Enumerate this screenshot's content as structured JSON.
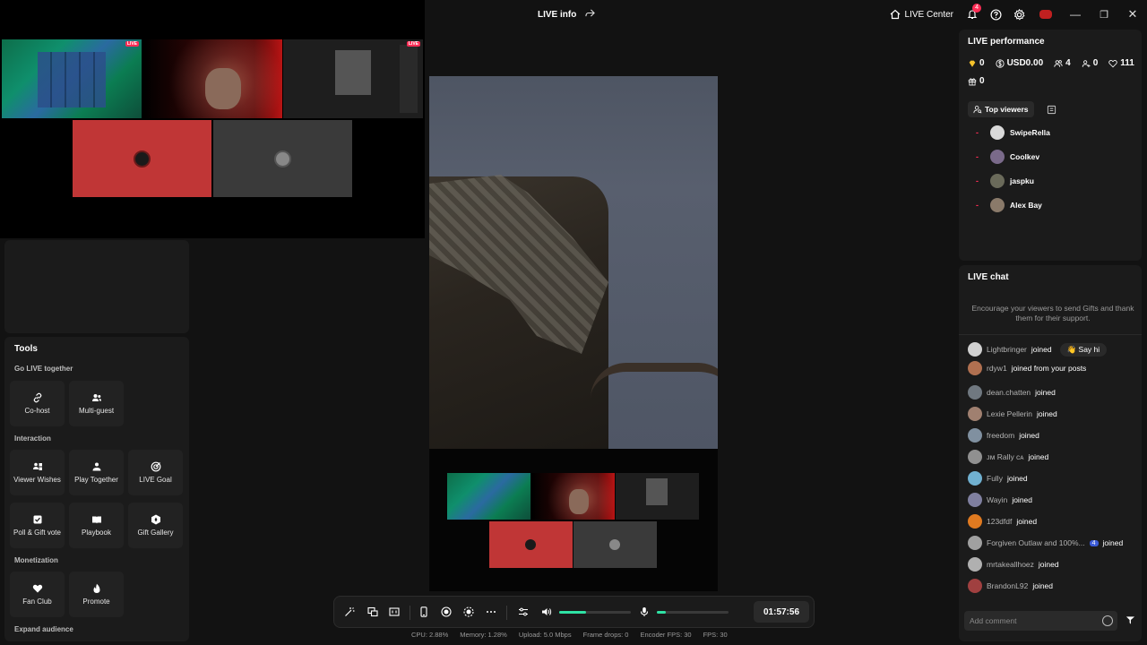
{
  "topbar": {
    "title": "LIVE info",
    "live_center": "LIVE Center",
    "notification_count": "4"
  },
  "tools": {
    "title": "Tools",
    "sections": {
      "go_live_together": "Go LIVE together",
      "interaction": "Interaction",
      "monetization": "Monetization",
      "expand_audience": "Expand audience"
    },
    "cohost": "Co-host",
    "multiguest": "Multi-guest",
    "viewer_wishes": "Viewer Wishes",
    "play_together": "Play Together",
    "live_goal": "LIVE Goal",
    "poll_gift_vote": "Poll & Gift vote",
    "playbook": "Playbook",
    "gift_gallery": "Gift Gallery",
    "fan_club": "Fan Club",
    "promote": "Promote"
  },
  "controls": {
    "timer": "01:57:56",
    "volume_level": 0.38,
    "mic_level": 0.12
  },
  "stats": {
    "cpu": "CPU:  2.88%",
    "memory": "Memory:  1.28%",
    "upload": "Upload:  5.0 Mbps",
    "frame_drops": "Frame drops:  0",
    "encoder_fps": "Encoder FPS:  30",
    "fps": "FPS:  30"
  },
  "performance": {
    "title": "LIVE performance",
    "diamonds": "0",
    "usd": "USD0.00",
    "viewers": "4",
    "new_followers": "0",
    "likes": "111",
    "gifts": "0",
    "top_viewers_tab": "Top viewers",
    "top_viewers": [
      {
        "name": "SwipeRella",
        "color": "#d9d9d9"
      },
      {
        "name": "Coolkev",
        "color": "#7a6a8a"
      },
      {
        "name": "jaspku",
        "color": "#6a6a5a"
      },
      {
        "name": "Alex Bay",
        "color": "#8a7a6a"
      }
    ]
  },
  "chat": {
    "title": "LIVE chat",
    "hint": "Encourage your viewers to send Gifts and thank them for their support.",
    "say_hi": "Say hi",
    "comment_placeholder": "Add comment",
    "messages": [
      {
        "user": "Lightbringer",
        "text": "joined",
        "color": "#d0d0d0"
      },
      {
        "user": "rdyw1",
        "text": "joined from your posts",
        "color": "#b07050"
      },
      {
        "user": "dean.chatten",
        "text": "joined",
        "color": "#707880"
      },
      {
        "user": "Lexie Pellerin",
        "text": "joined",
        "color": "#a08070"
      },
      {
        "user": "freedom",
        "text": "joined",
        "color": "#8090a0"
      },
      {
        "user": "ᴊᴍ Rally ᴄᴀ",
        "text": "joined",
        "color": "#909090"
      },
      {
        "user": "Fully",
        "text": "joined",
        "color": "#70b0d0"
      },
      {
        "user": "Wayin",
        "text": "joined",
        "color": "#8080a0"
      },
      {
        "user": "123dfdf",
        "text": "joined",
        "color": "#e07a20"
      },
      {
        "user": "Forgiven Outlaw and 100%...",
        "text": "joined",
        "badge": "4",
        "color": "#a0a0a0"
      },
      {
        "user": "mrtakeallhoez",
        "text": "joined",
        "color": "#b0b0b0"
      },
      {
        "user": "BrandonL92",
        "text": "joined",
        "color": "#a04040"
      }
    ]
  }
}
